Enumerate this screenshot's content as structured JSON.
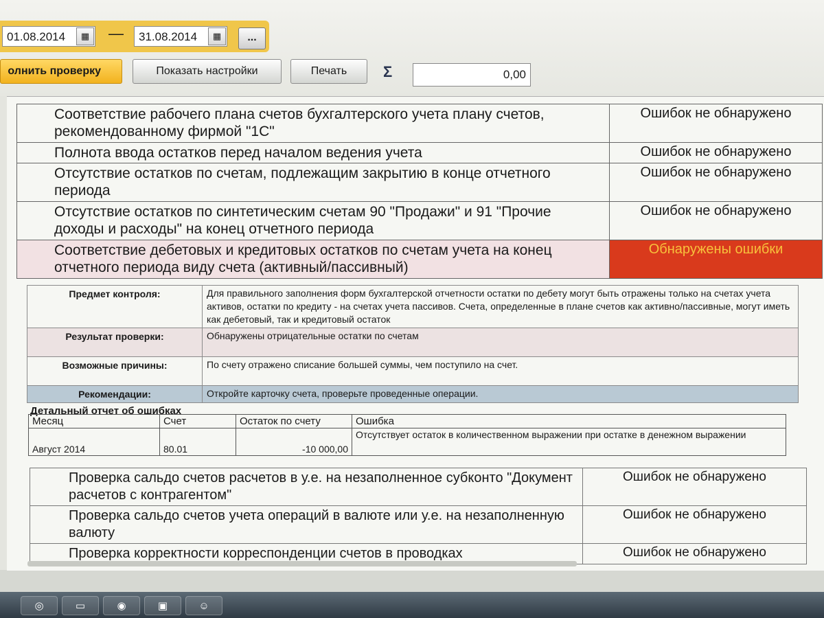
{
  "toolbar": {
    "date_from": "01.08.2014",
    "date_to": "31.08.2014",
    "date_separator": "—",
    "more_button": "...",
    "run_check_button": "олнить проверку",
    "show_settings_button": "Показать настройки",
    "print_button": "Печать",
    "sigma_symbol": "Σ",
    "sum_value": "0,00"
  },
  "checks": [
    {
      "name": "Соответствие рабочего плана счетов бухгалтерского учета плану счетов, рекомендованному фирмой \"1С\"",
      "result": "Ошибок не обнаружено"
    },
    {
      "name": "Полнота ввода остатков перед началом ведения учета",
      "result": "Ошибок не обнаружено"
    },
    {
      "name": "Отсутствие остатков по счетам, подлежащим закрытию в конце отчетного периода",
      "result": "Ошибок не обнаружено"
    },
    {
      "name": "Отсутствие остатков по синтетическим счетам 90 \"Продажи\" и 91 \"Прочие доходы и расходы\" на конец отчетного периода",
      "result": "Ошибок не обнаружено"
    },
    {
      "name": "Соответствие дебетовых и кредитовых остатков по счетам учета на конец отчетного периода виду счета (активный/пассивный)",
      "result": "Обнаружены ошибки"
    }
  ],
  "details": [
    {
      "label": "Предмет контроля:",
      "value": "Для правильного заполнения форм бухгалтерской отчетности остатки по дебету могут быть отражены только на счетах учета активов, остатки по кредиту - на счетах учета пассивов. Счета, определенные в плане счетов как активно/пассивные, могут иметь как дебетовый, так и кредитовый остаток"
    },
    {
      "label": "Результат проверки:",
      "value": "Обнаружены отрицательные остатки по счетам"
    },
    {
      "label": "Возможные причины:",
      "value": "По счету отражено списание большей суммы, чем поступило на счет."
    },
    {
      "label": "Рекомендации:",
      "value": "Откройте карточку счета, проверьте проведенные операции."
    }
  ],
  "error_report": {
    "title": "Детальный отчет об ошибках",
    "columns": [
      "Месяц",
      "Счет",
      "Остаток по счету",
      "Ошибка"
    ],
    "rows": [
      {
        "month": "Август 2014",
        "account": "80.01",
        "balance": "-10 000,00",
        "error": "Отсутствует остаток в количественном выражении при остатке в денежном выражении"
      }
    ]
  },
  "checks_more": [
    {
      "name": "Проверка сальдо счетов расчетов в у.е. на незаполненное субконто \"Документ расчетов с контрагентом\"",
      "result": "Ошибок не обнаружено"
    },
    {
      "name": "Проверка сальдо счетов учета операций в валюте или у.е. на незаполненную валюту",
      "result": "Ошибок не обнаружено"
    },
    {
      "name": "Проверка корректности корреспонденции счетов в проводках",
      "result": "Ошибок не обнаружено"
    }
  ],
  "colors": {
    "accent": "#f0c64a",
    "error_bg": "#d93a1c",
    "error_text": "#f7c13c"
  },
  "taskbar_icons": [
    "ie-icon",
    "folder-icon",
    "chrome-icon",
    "1c-icon",
    "user-icon"
  ]
}
